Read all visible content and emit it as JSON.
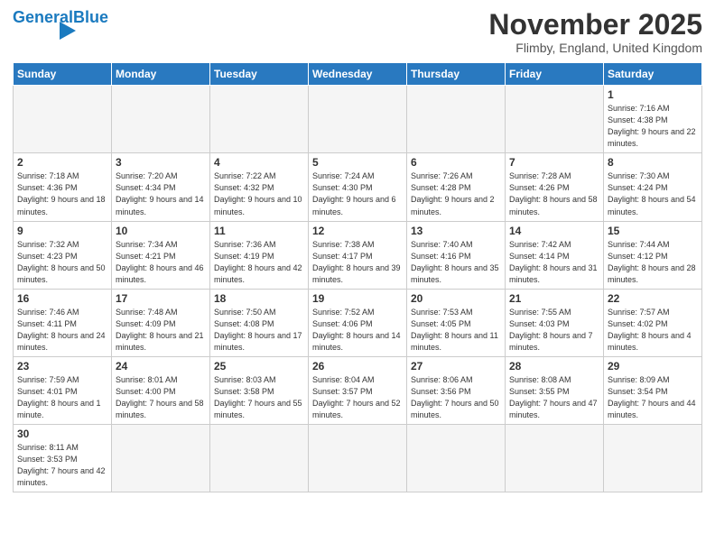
{
  "logo": {
    "text_general": "General",
    "text_blue": "Blue"
  },
  "header": {
    "title": "November 2025",
    "location": "Flimby, England, United Kingdom"
  },
  "weekdays": [
    "Sunday",
    "Monday",
    "Tuesday",
    "Wednesday",
    "Thursday",
    "Friday",
    "Saturday"
  ],
  "weeks": [
    [
      {
        "day": "",
        "info": ""
      },
      {
        "day": "",
        "info": ""
      },
      {
        "day": "",
        "info": ""
      },
      {
        "day": "",
        "info": ""
      },
      {
        "day": "",
        "info": ""
      },
      {
        "day": "",
        "info": ""
      },
      {
        "day": "1",
        "info": "Sunrise: 7:16 AM\nSunset: 4:38 PM\nDaylight: 9 hours\nand 22 minutes."
      }
    ],
    [
      {
        "day": "2",
        "info": "Sunrise: 7:18 AM\nSunset: 4:36 PM\nDaylight: 9 hours\nand 18 minutes."
      },
      {
        "day": "3",
        "info": "Sunrise: 7:20 AM\nSunset: 4:34 PM\nDaylight: 9 hours\nand 14 minutes."
      },
      {
        "day": "4",
        "info": "Sunrise: 7:22 AM\nSunset: 4:32 PM\nDaylight: 9 hours\nand 10 minutes."
      },
      {
        "day": "5",
        "info": "Sunrise: 7:24 AM\nSunset: 4:30 PM\nDaylight: 9 hours\nand 6 minutes."
      },
      {
        "day": "6",
        "info": "Sunrise: 7:26 AM\nSunset: 4:28 PM\nDaylight: 9 hours\nand 2 minutes."
      },
      {
        "day": "7",
        "info": "Sunrise: 7:28 AM\nSunset: 4:26 PM\nDaylight: 8 hours\nand 58 minutes."
      },
      {
        "day": "8",
        "info": "Sunrise: 7:30 AM\nSunset: 4:24 PM\nDaylight: 8 hours\nand 54 minutes."
      }
    ],
    [
      {
        "day": "9",
        "info": "Sunrise: 7:32 AM\nSunset: 4:23 PM\nDaylight: 8 hours\nand 50 minutes."
      },
      {
        "day": "10",
        "info": "Sunrise: 7:34 AM\nSunset: 4:21 PM\nDaylight: 8 hours\nand 46 minutes."
      },
      {
        "day": "11",
        "info": "Sunrise: 7:36 AM\nSunset: 4:19 PM\nDaylight: 8 hours\nand 42 minutes."
      },
      {
        "day": "12",
        "info": "Sunrise: 7:38 AM\nSunset: 4:17 PM\nDaylight: 8 hours\nand 39 minutes."
      },
      {
        "day": "13",
        "info": "Sunrise: 7:40 AM\nSunset: 4:16 PM\nDaylight: 8 hours\nand 35 minutes."
      },
      {
        "day": "14",
        "info": "Sunrise: 7:42 AM\nSunset: 4:14 PM\nDaylight: 8 hours\nand 31 minutes."
      },
      {
        "day": "15",
        "info": "Sunrise: 7:44 AM\nSunset: 4:12 PM\nDaylight: 8 hours\nand 28 minutes."
      }
    ],
    [
      {
        "day": "16",
        "info": "Sunrise: 7:46 AM\nSunset: 4:11 PM\nDaylight: 8 hours\nand 24 minutes."
      },
      {
        "day": "17",
        "info": "Sunrise: 7:48 AM\nSunset: 4:09 PM\nDaylight: 8 hours\nand 21 minutes."
      },
      {
        "day": "18",
        "info": "Sunrise: 7:50 AM\nSunset: 4:08 PM\nDaylight: 8 hours\nand 17 minutes."
      },
      {
        "day": "19",
        "info": "Sunrise: 7:52 AM\nSunset: 4:06 PM\nDaylight: 8 hours\nand 14 minutes."
      },
      {
        "day": "20",
        "info": "Sunrise: 7:53 AM\nSunset: 4:05 PM\nDaylight: 8 hours\nand 11 minutes."
      },
      {
        "day": "21",
        "info": "Sunrise: 7:55 AM\nSunset: 4:03 PM\nDaylight: 8 hours\nand 7 minutes."
      },
      {
        "day": "22",
        "info": "Sunrise: 7:57 AM\nSunset: 4:02 PM\nDaylight: 8 hours\nand 4 minutes."
      }
    ],
    [
      {
        "day": "23",
        "info": "Sunrise: 7:59 AM\nSunset: 4:01 PM\nDaylight: 8 hours\nand 1 minute."
      },
      {
        "day": "24",
        "info": "Sunrise: 8:01 AM\nSunset: 4:00 PM\nDaylight: 7 hours\nand 58 minutes."
      },
      {
        "day": "25",
        "info": "Sunrise: 8:03 AM\nSunset: 3:58 PM\nDaylight: 7 hours\nand 55 minutes."
      },
      {
        "day": "26",
        "info": "Sunrise: 8:04 AM\nSunset: 3:57 PM\nDaylight: 7 hours\nand 52 minutes."
      },
      {
        "day": "27",
        "info": "Sunrise: 8:06 AM\nSunset: 3:56 PM\nDaylight: 7 hours\nand 50 minutes."
      },
      {
        "day": "28",
        "info": "Sunrise: 8:08 AM\nSunset: 3:55 PM\nDaylight: 7 hours\nand 47 minutes."
      },
      {
        "day": "29",
        "info": "Sunrise: 8:09 AM\nSunset: 3:54 PM\nDaylight: 7 hours\nand 44 minutes."
      }
    ],
    [
      {
        "day": "30",
        "info": "Sunrise: 8:11 AM\nSunset: 3:53 PM\nDaylight: 7 hours\nand 42 minutes."
      },
      {
        "day": "",
        "info": ""
      },
      {
        "day": "",
        "info": ""
      },
      {
        "day": "",
        "info": ""
      },
      {
        "day": "",
        "info": ""
      },
      {
        "day": "",
        "info": ""
      },
      {
        "day": "",
        "info": ""
      }
    ]
  ]
}
